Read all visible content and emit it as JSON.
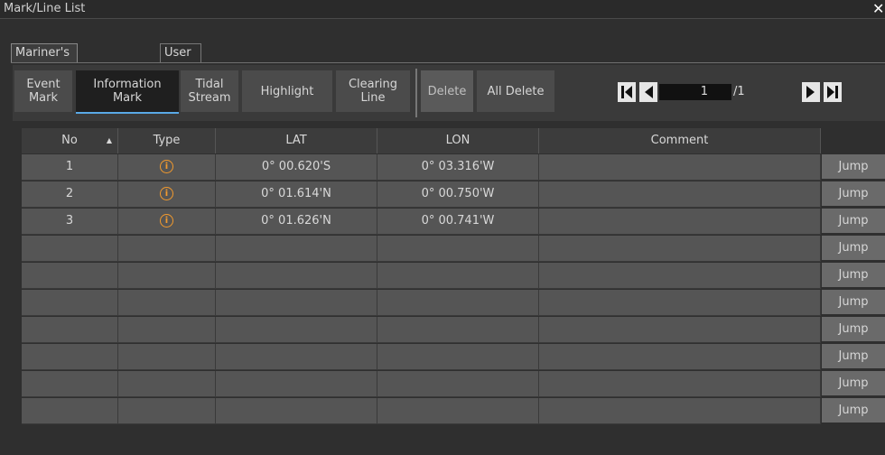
{
  "window": {
    "title": "Mark/Line List",
    "close_icon": "close-icon"
  },
  "tabs": [
    {
      "label": "Mariner's Mark/Line",
      "active": true
    },
    {
      "label": "User Chart",
      "active": false
    }
  ],
  "toolbar": {
    "mark_types": [
      {
        "line1": "Event",
        "line2": "Mark",
        "selected": false
      },
      {
        "line1": "Information",
        "line2": "Mark",
        "selected": true
      },
      {
        "line1": "Tidal",
        "line2": "Stream",
        "selected": false
      },
      {
        "line1": "Highlight",
        "line2": "",
        "selected": false
      },
      {
        "line1": "Clearing",
        "line2": "Line",
        "selected": false
      }
    ],
    "delete_label": "Delete",
    "all_delete_label": "All Delete",
    "pager": {
      "current": "1",
      "total": "/1"
    }
  },
  "table": {
    "headers": [
      "No",
      "Type",
      "LAT",
      "LON",
      "Comment"
    ],
    "sort_indicator": "▲",
    "rows": [
      {
        "no": "1",
        "type_icon": "info-icon",
        "lat": "0° 00.620'S",
        "lon": "0° 03.316'W",
        "comment": ""
      },
      {
        "no": "2",
        "type_icon": "info-icon",
        "lat": "0° 01.614'N",
        "lon": "0° 00.750'W",
        "comment": ""
      },
      {
        "no": "3",
        "type_icon": "info-icon",
        "lat": "0° 01.626'N",
        "lon": "0° 00.741'W",
        "comment": ""
      },
      {
        "no": "",
        "type_icon": "",
        "lat": "",
        "lon": "",
        "comment": ""
      },
      {
        "no": "",
        "type_icon": "",
        "lat": "",
        "lon": "",
        "comment": ""
      },
      {
        "no": "",
        "type_icon": "",
        "lat": "",
        "lon": "",
        "comment": ""
      },
      {
        "no": "",
        "type_icon": "",
        "lat": "",
        "lon": "",
        "comment": ""
      },
      {
        "no": "",
        "type_icon": "",
        "lat": "",
        "lon": "",
        "comment": ""
      },
      {
        "no": "",
        "type_icon": "",
        "lat": "",
        "lon": "",
        "comment": ""
      },
      {
        "no": "",
        "type_icon": "",
        "lat": "",
        "lon": "",
        "comment": ""
      }
    ],
    "jump_label": "Jump"
  },
  "colors": {
    "accent": "#5aa9e6",
    "info_icon": "#f29a2e"
  }
}
